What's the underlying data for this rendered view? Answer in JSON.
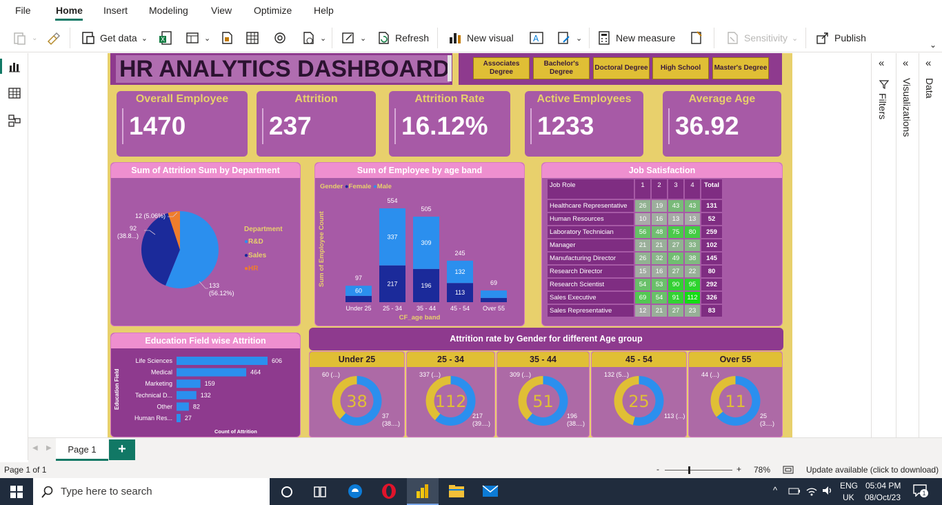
{
  "menu": [
    "File",
    "Home",
    "Insert",
    "Modeling",
    "View",
    "Optimize",
    "Help"
  ],
  "ribbon": {
    "get_data": "Get data",
    "refresh": "Refresh",
    "new_visual": "New visual",
    "new_measure": "New measure",
    "sensitivity": "Sensitivity",
    "publish": "Publish"
  },
  "dashboard": {
    "title": "HR ANALYTICS DASHBOARD",
    "slicers": [
      "Associates Degree",
      "Bachelor's Degree",
      "Doctoral Degree",
      "High School",
      "Master's Degree"
    ],
    "kpis": [
      {
        "title": "Overall Employee",
        "value": "1470"
      },
      {
        "title": "Attrition",
        "value": "237"
      },
      {
        "title": "Attrition Rate",
        "value": "16.12%"
      },
      {
        "title": "Active Employees",
        "value": "1233"
      },
      {
        "title": "Average Age",
        "value": "36.92"
      }
    ]
  },
  "dept_chart": {
    "title": "Sum of Attrition Sum by Department",
    "legend_title": "Department",
    "slices": [
      {
        "name": "R&D",
        "value": 133,
        "label_value": "133",
        "label_pct": "(56.12%)",
        "color": "#2b8fee"
      },
      {
        "name": "Sales",
        "value": 92,
        "label_value": "92",
        "label_pct": "(38.8...)",
        "color": "#1b2a9a"
      },
      {
        "name": "HR",
        "value": 12,
        "label_value": "12 (5.06%)",
        "label_pct": "",
        "color": "#ef7d2c"
      }
    ]
  },
  "age_chart": {
    "title": "Sum of Employee by age band",
    "legend_title": "Gender",
    "legend": [
      {
        "name": "Female",
        "color": "#1b2a9a"
      },
      {
        "name": "Male",
        "color": "#2b8fee"
      }
    ],
    "ylabel": "Sum of Employee Count",
    "xlabel": "CF_age band",
    "bands": [
      {
        "label": "Under 25",
        "female": 37,
        "male": 60,
        "total": "97",
        "female_label": "",
        "male_label": "60"
      },
      {
        "label": "25 - 34",
        "female": 217,
        "male": 337,
        "total": "554",
        "female_label": "217",
        "male_label": "337"
      },
      {
        "label": "35 - 44",
        "female": 196,
        "male": 309,
        "total": "505",
        "female_label": "196",
        "male_label": "309"
      },
      {
        "label": "45 - 54",
        "female": 113,
        "male": 132,
        "total": "245",
        "female_label": "113",
        "male_label": "132"
      },
      {
        "label": "Over 55",
        "female": 25,
        "male": 44,
        "total": "69",
        "female_label": "",
        "male_label": ""
      }
    ]
  },
  "job_satisfaction": {
    "title": "Job Satisfaction",
    "headers": [
      "Job Role",
      "1",
      "2",
      "3",
      "4",
      "Total"
    ],
    "rows": [
      {
        "role": "Healthcare Representative",
        "v": [
          26,
          19,
          43,
          43
        ],
        "total": "131"
      },
      {
        "role": "Human Resources",
        "v": [
          10,
          16,
          13,
          13
        ],
        "total": "52"
      },
      {
        "role": "Laboratory Technician",
        "v": [
          56,
          48,
          75,
          80
        ],
        "total": "259"
      },
      {
        "role": "Manager",
        "v": [
          21,
          21,
          27,
          33
        ],
        "total": "102"
      },
      {
        "role": "Manufacturing Director",
        "v": [
          26,
          32,
          49,
          38
        ],
        "total": "145"
      },
      {
        "role": "Research Director",
        "v": [
          15,
          16,
          27,
          22
        ],
        "total": "80"
      },
      {
        "role": "Research Scientist",
        "v": [
          54,
          53,
          90,
          95
        ],
        "total": "292"
      },
      {
        "role": "Sales Executive",
        "v": [
          69,
          54,
          91,
          112
        ],
        "total": "326"
      },
      {
        "role": "Sales Representative",
        "v": [
          12,
          21,
          27,
          23
        ],
        "total": "83"
      }
    ]
  },
  "edu_chart": {
    "title": "Education Field wise Attrition",
    "ylabel": "Education Field",
    "xlabel": "Count of Attrition",
    "bars": [
      {
        "label": "Life Sciences",
        "value": 606
      },
      {
        "label": "Medical",
        "value": 464
      },
      {
        "label": "Marketing",
        "value": 159
      },
      {
        "label": "Technical D...",
        "value": 132
      },
      {
        "label": "Other",
        "value": 82
      },
      {
        "label": "Human Res...",
        "value": 27
      }
    ]
  },
  "gender_age": {
    "title": "Attrition rate by  Gender for different Age group",
    "groups": [
      {
        "label": "Under 25",
        "center": "38",
        "male": 60,
        "female": 37,
        "male_label": "60 (...)",
        "female_label": "37",
        "female_pct": "(38....)"
      },
      {
        "label": "25 - 34",
        "center": "112",
        "male": 337,
        "female": 217,
        "male_label": "337 (...)",
        "female_label": "217",
        "female_pct": "(39....)"
      },
      {
        "label": "35 - 44",
        "center": "51",
        "male": 309,
        "female": 196,
        "male_label": "309 (...)",
        "female_label": "196",
        "female_pct": "(38....)"
      },
      {
        "label": "45 - 54",
        "center": "25",
        "male": 132,
        "female": 113,
        "male_label": "132 (5...)",
        "female_label": "113 (...)",
        "female_pct": ""
      },
      {
        "label": "Over 55",
        "center": "11",
        "male": 44,
        "female": 25,
        "male_label": "44 (...)",
        "female_label": "25",
        "female_pct": "(3....)"
      }
    ]
  },
  "panes": {
    "filters": "Filters",
    "visualizations": "Visualizations",
    "data": "Data"
  },
  "pages": {
    "tab": "Page 1",
    "add": "+"
  },
  "status": {
    "page": "Page 1 of 1",
    "zoom": "78%",
    "update": "Update available (click to download)",
    "zoom_minus": "-",
    "zoom_plus": "+"
  },
  "taskbar": {
    "search": "Type here to search",
    "lang1": "ENG",
    "lang2": "UK",
    "time": "05:04 PM",
    "date": "08/Oct/23",
    "notif": "1"
  },
  "colors": {
    "accent": "#117865",
    "report_bg": "#e8d06c",
    "card": "#a75aa6",
    "header_pink": "#ee8fcf",
    "male": "#2b8fee",
    "female": "#1b2a9a",
    "donut_female": "#e0bf35"
  }
}
